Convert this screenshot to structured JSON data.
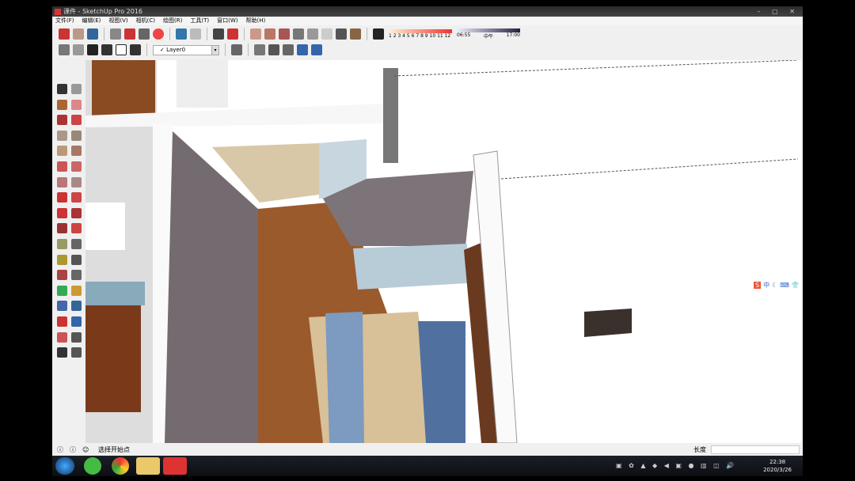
{
  "window": {
    "title": "课件 - SketchUp Pro 2016",
    "controls": "– ▢ ✕"
  },
  "menu": [
    "文件(F)",
    "编辑(E)",
    "视图(V)",
    "相机(C)",
    "绘图(R)",
    "工具(T)",
    "窗口(W)",
    "帮助(H)"
  ],
  "toolbar": {
    "layer_value": "✓  Layer0",
    "shadow_months": "1 2 3 4 5 6 7 8 9 10 11 12",
    "shadow_time_start": "06:55",
    "shadow_time_mid": "中午",
    "shadow_time_end": "17:00"
  },
  "status": {
    "prompt": "选择开始点",
    "measure_label": "长度",
    "measure_value": ""
  },
  "ime": {
    "mode": "中"
  },
  "taskbar": {
    "time": "22:38",
    "date": "2020/3/26"
  },
  "colors": {
    "titlebar": "#333333",
    "floor": "#9a5a2c",
    "wall": "#7d7479",
    "accent": "#d33333"
  }
}
